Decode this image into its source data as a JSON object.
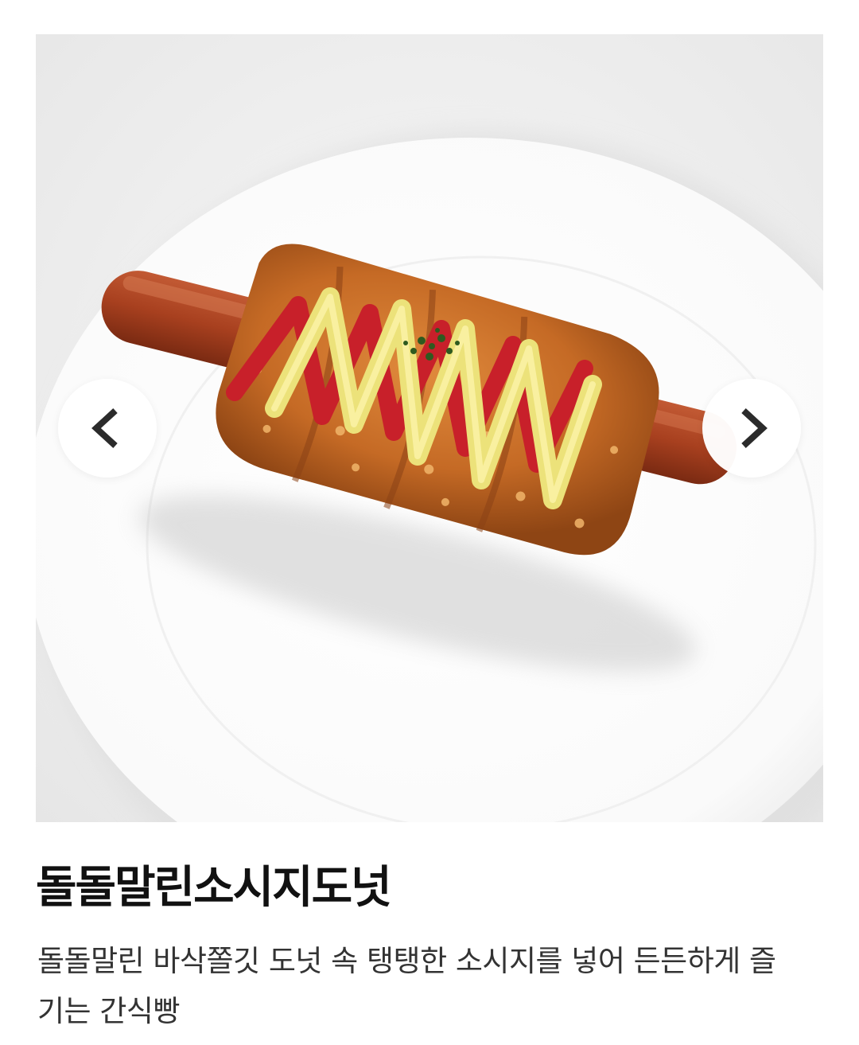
{
  "product": {
    "name": "돌돌말린소시지도넛",
    "description": "돌돌말린 바삭쫄깃 도넛 속 탱탱한 소시지를 넣어 든든하게 즐기는 간식빵"
  },
  "carousel": {
    "prev_icon": "chevron-left-icon",
    "next_icon": "chevron-right-icon"
  },
  "colors": {
    "title": "#111111",
    "description": "#333333",
    "nav_button_bg": "#ffffff",
    "chevron": "#2b2b2b"
  }
}
